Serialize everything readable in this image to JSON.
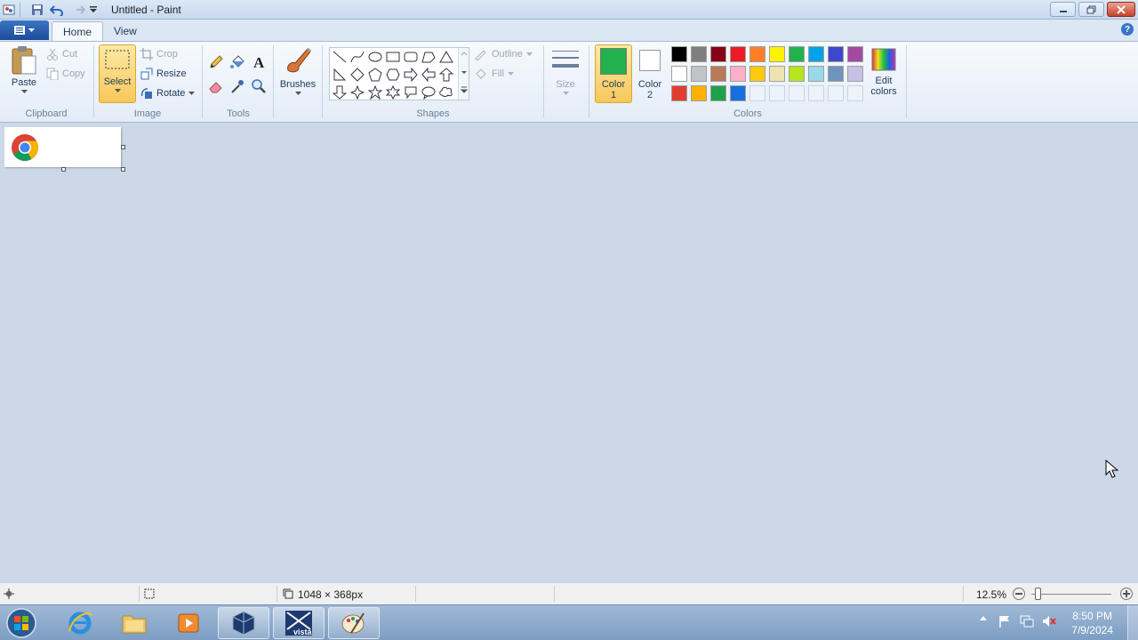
{
  "window": {
    "title": "Untitled - Paint"
  },
  "tabs": {
    "file_icon": "menu-icon",
    "home": "Home",
    "view": "View"
  },
  "clipboard": {
    "paste": "Paste",
    "cut": "Cut",
    "copy": "Copy",
    "label": "Clipboard"
  },
  "image": {
    "select": "Select",
    "crop": "Crop",
    "resize": "Resize",
    "rotate": "Rotate",
    "label": "Image"
  },
  "tools": {
    "label": "Tools",
    "items": [
      "pencil-icon",
      "fill-icon",
      "text-icon",
      "eraser-icon",
      "color-picker-icon",
      "magnifier-icon"
    ]
  },
  "brushes": {
    "label": "Brushes"
  },
  "shapes": {
    "label": "Shapes",
    "outline": "Outline",
    "fill": "Fill"
  },
  "size": {
    "label": "Size"
  },
  "colors": {
    "color1_line1": "Color",
    "color1_line2": "1",
    "color2_line1": "Color",
    "color2_line2": "2",
    "edit_line1": "Edit",
    "edit_line2": "colors",
    "label": "Colors",
    "color1_value": "#22b14c",
    "color2_value": "#ffffff",
    "palette_row1": [
      "#000000",
      "#7f7f7f",
      "#880015",
      "#ed1c24",
      "#ff7f27",
      "#fff200",
      "#22b14c",
      "#00a2e8",
      "#3f48cc",
      "#a349a4"
    ],
    "palette_row2": [
      "#ffffff",
      "#c3c3c3",
      "#b97a57",
      "#ffaec9",
      "#ffc90e",
      "#efe4b0",
      "#b5e61d",
      "#99d9ea",
      "#7092be",
      "#c8bfe7"
    ],
    "palette_row3": [
      "#e03c31",
      "#ffb000",
      "#1fa04a",
      "#1570e0"
    ]
  },
  "status": {
    "size": "1048 × 368px",
    "zoom": "12.5%",
    "zoom_level": 0.125
  },
  "taskbar": {
    "time": "8:50 PM",
    "date": "7/9/2024",
    "vista_label": "vista"
  }
}
